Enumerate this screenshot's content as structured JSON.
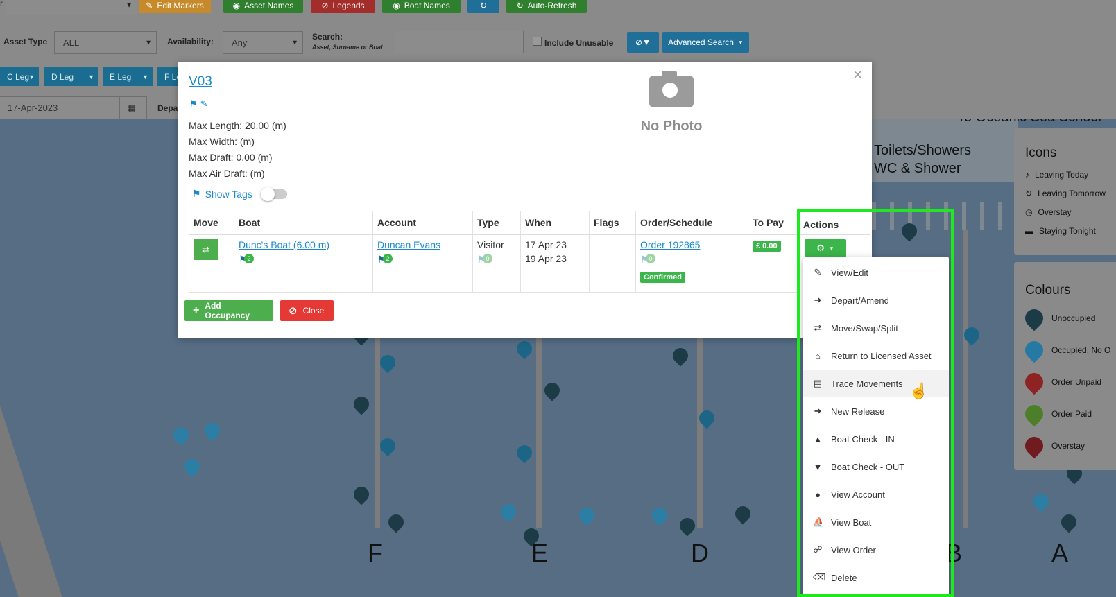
{
  "toolbar": {
    "top_select_value": "",
    "buttons": [
      {
        "label": "Edit Markers",
        "icon": "edit-icon",
        "color": "#c78a2a"
      },
      {
        "label": "Asset Names",
        "icon": "eye-icon",
        "color": "#2f7f2f"
      },
      {
        "label": "Legends",
        "icon": "eye-slash-icon",
        "color": "#a32d2a"
      },
      {
        "label": "Boat Names",
        "icon": "eye-icon",
        "color": "#2f7f2f"
      },
      {
        "label": "",
        "icon": "refresh-icon",
        "color": "#1f6f98"
      },
      {
        "label": "Auto-Refresh",
        "icon": "refresh-icon",
        "color": "#2f7f2f"
      }
    ],
    "asset_type_label": "Asset Type",
    "asset_type_value": "ALL",
    "availability_label": "Availability:",
    "availability_value": "Any",
    "search_label": "Search:",
    "search_hint": "Asset, Surname or Boat",
    "search_value": "",
    "include_unusable_label": "Include Unusable",
    "advanced_search_label": "Advanced Search",
    "legs": [
      "C Leg",
      "D Leg",
      "E Leg",
      "F Le"
    ],
    "date_value": "17-Apr-2023",
    "depart_label": "Depa"
  },
  "map": {
    "piers": [
      "F",
      "E",
      "D",
      "B",
      "A"
    ],
    "area_labels": [
      "Toilets/Showers",
      "WC & Shower",
      "To Oceanic Sea School"
    ],
    "icons_panel": {
      "title": "Icons",
      "items": [
        {
          "icon": "bell-icon",
          "label": "Leaving Today"
        },
        {
          "icon": "redo-icon",
          "label": "Leaving Tomorrow"
        },
        {
          "icon": "alarm-clock-icon",
          "label": "Overstay"
        },
        {
          "icon": "bed-icon",
          "label": "Staying Tonight"
        }
      ]
    },
    "colours_panel": {
      "title": "Colours",
      "items": [
        {
          "color": "#1d3a47",
          "label": "Unoccupied"
        },
        {
          "color": "#2679a3",
          "label": "Occupied, No O"
        },
        {
          "color": "#8e2323",
          "label": "Order Unpaid"
        },
        {
          "color": "#4d7f2a",
          "label": "Order Paid"
        },
        {
          "color": "#6f1b20",
          "label": "Overstay"
        }
      ]
    }
  },
  "modal": {
    "asset_name": "V03",
    "specs": [
      "Max Length: 20.00 (m)",
      "Max Width: (m)",
      "Max Draft: 0.00 (m)",
      "Max Air Draft: (m)"
    ],
    "no_photo_label": "No Photo",
    "show_tags_label": "Show Tags",
    "table": {
      "headers": [
        "Move",
        "Boat",
        "Account",
        "Type",
        "When",
        "Flags",
        "Order/Schedule",
        "To Pay",
        "Actions"
      ],
      "row": {
        "boat": "Dunc's Boat (6.00 m)",
        "boat_tags": "2",
        "account": "Duncan Evans",
        "account_tags": "2",
        "type": "Visitor",
        "type_tags": "0",
        "when_from": "17 Apr 23",
        "when_to": "19 Apr 23",
        "flags": "",
        "order": "Order 192865",
        "order_tags": "0",
        "order_status": "Confirmed",
        "to_pay": "£ 0.00"
      }
    },
    "add_occupancy_label": "Add Occupancy",
    "close_label": "Close"
  },
  "actions_menu": [
    {
      "icon": "edit-icon",
      "label": "View/Edit"
    },
    {
      "icon": "sign-out-icon",
      "label": "Depart/Amend"
    },
    {
      "icon": "shuffle-icon",
      "label": "Move/Swap/Split"
    },
    {
      "icon": "home-icon",
      "label": "Return to Licensed Asset"
    },
    {
      "icon": "road-sign-icon",
      "label": "Trace Movements"
    },
    {
      "icon": "release-icon",
      "label": "New Release"
    },
    {
      "icon": "thumbs-up-icon",
      "label": "Boat Check - IN"
    },
    {
      "icon": "thumbs-down-icon",
      "label": "Boat Check - OUT"
    },
    {
      "icon": "user-icon",
      "label": "View Account"
    },
    {
      "icon": "ship-icon",
      "label": "View Boat"
    },
    {
      "icon": "cart-icon",
      "label": "View Order"
    },
    {
      "icon": "trash-icon",
      "label": "Delete"
    }
  ],
  "colors": {
    "highlight": "#1ee81e",
    "primary": "#1a8acb",
    "success": "#3cb54a",
    "danger": "#e53935"
  }
}
